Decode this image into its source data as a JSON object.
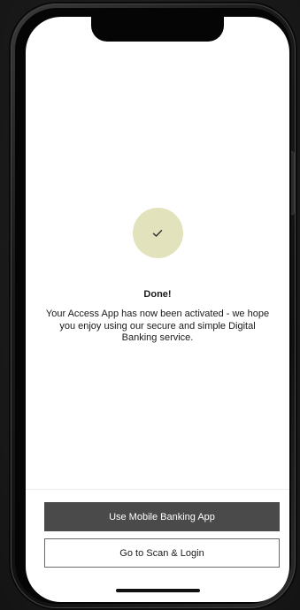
{
  "screen": {
    "icon": "checkmark-icon",
    "title": "Done!",
    "message": "Your Access App has now been activated - we hope you enjoy using our secure and simple Digital Banking service."
  },
  "actions": {
    "primary_label": "Use Mobile Banking App",
    "secondary_label": "Go to Scan & Login"
  },
  "colors": {
    "check_circle": "#e2e2bd",
    "primary_button": "#4a4a4a",
    "background": "#ffffff"
  }
}
